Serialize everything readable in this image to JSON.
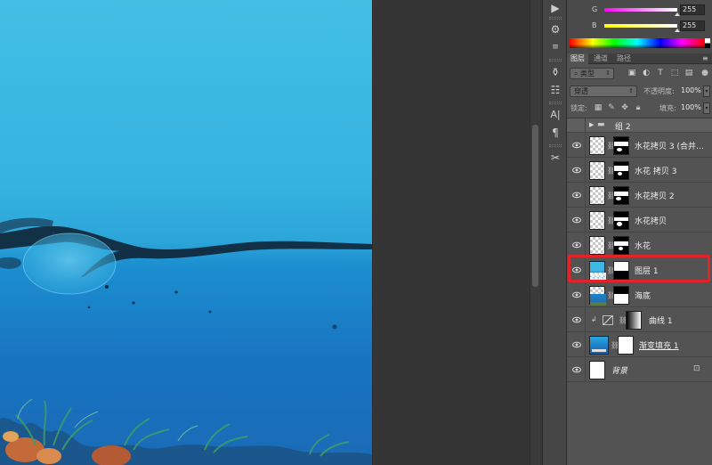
{
  "color_panel": {
    "sliders": [
      {
        "label": "G",
        "value": "255",
        "color": "#ff00ff"
      },
      {
        "label": "B",
        "value": "255",
        "color": "#ffff00"
      }
    ]
  },
  "layers_panel": {
    "tabs": [
      {
        "label": "图层",
        "active": true
      },
      {
        "label": "通道",
        "active": false
      },
      {
        "label": "路径",
        "active": false
      }
    ],
    "filter_kind": "类型",
    "blend_mode": "穿透",
    "opacity_label": "不透明度:",
    "opacity_value": "100%",
    "lock_label": "锁定:",
    "fill_label": "填充:",
    "fill_value": "100%",
    "layers": [
      {
        "name": "组 2",
        "kind": "group",
        "visible": false
      },
      {
        "name": "水花拷贝 3 (合并…",
        "kind": "masked",
        "visible": true
      },
      {
        "name": "水花 拷贝 3",
        "kind": "masked",
        "visible": true
      },
      {
        "name": "水花拷贝 2",
        "kind": "masked",
        "visible": true
      },
      {
        "name": "水花拷贝",
        "kind": "masked",
        "visible": true
      },
      {
        "name": "水花",
        "kind": "masked",
        "visible": true
      },
      {
        "name": "图层 1",
        "kind": "masked-blue",
        "visible": true,
        "highlighted": true
      },
      {
        "name": "海底",
        "kind": "masked-sea",
        "visible": true
      },
      {
        "name": "曲线 1",
        "kind": "adjustment",
        "visible": true
      },
      {
        "name": "渐变填充 1",
        "kind": "gradient",
        "visible": true
      },
      {
        "name": "背景",
        "kind": "background",
        "visible": true,
        "locked": true
      }
    ]
  },
  "highlight_color": "#e2242a"
}
